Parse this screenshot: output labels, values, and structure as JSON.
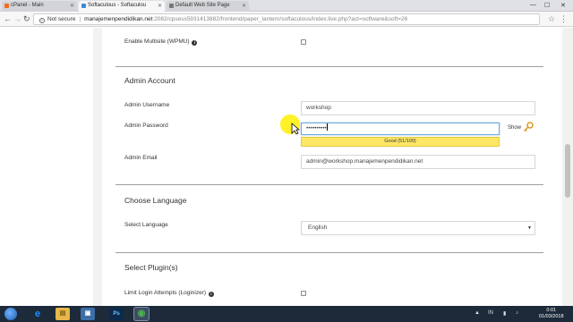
{
  "browser": {
    "tabs": [
      {
        "label": "cPanel - Main",
        "favicon_color": "#f26b21",
        "active": false
      },
      {
        "label": "Softaculous - Softaculou",
        "favicon_color": "#3d8bd8",
        "active": true
      },
      {
        "label": "Default Web Site Page",
        "favicon_color": "#777777",
        "active": false
      }
    ],
    "window_controls": {
      "minimize": "—",
      "maximize": "☐",
      "close": "✕"
    },
    "nav": {
      "back": "←",
      "forward": "→",
      "reload": "↻"
    },
    "address": {
      "security_label": "Not secure",
      "host": "manajemenpendidikan.net",
      "path": ":2082/cpsess5931413882/frontend/paper_lantern/softaculous/index.live.php?act=software&soft=26"
    },
    "star_icon": "☆",
    "menu_icon": "⋮"
  },
  "form": {
    "multisite": {
      "label": "Enable Multisite (WPMU)",
      "info": "i",
      "checked": false
    },
    "admin_section": {
      "title": "Admin Account",
      "username": {
        "label": "Admin Username",
        "value": "workshop"
      },
      "password": {
        "label": "Admin Password",
        "value": "••••••••••",
        "show_label": "Show",
        "strength_text": "Good (51/100)",
        "strength": 0.51
      },
      "email": {
        "label": "Admin Email",
        "value": "admin@workshop.manajemenpendidikan.net"
      }
    },
    "language_section": {
      "title": "Choose Language",
      "select_label": "Select Language",
      "selected": "English"
    },
    "plugins_section": {
      "title": "Select Plugin(s)",
      "limit_login": {
        "label": "Limit Login Attempts (Loginizer)",
        "info": "i",
        "checked": false
      }
    }
  },
  "taskbar": {
    "apps": [
      {
        "name": "internet-explorer",
        "glyph": "e",
        "color": "#1e90ff"
      },
      {
        "name": "file-explorer",
        "glyph": "▤",
        "color": "#e8b64a"
      },
      {
        "name": "media",
        "glyph": "▣",
        "color": "#3c6ea8"
      },
      {
        "name": "photoshop",
        "glyph": "Ps",
        "color": "#0d2a4a"
      },
      {
        "name": "chrome",
        "glyph": "◉",
        "color": "#4caf50"
      }
    ],
    "tray": {
      "lang": "IN",
      "up_arrow": "▲"
    },
    "clock": {
      "time": "0:01",
      "date": "01/03/2018"
    }
  }
}
